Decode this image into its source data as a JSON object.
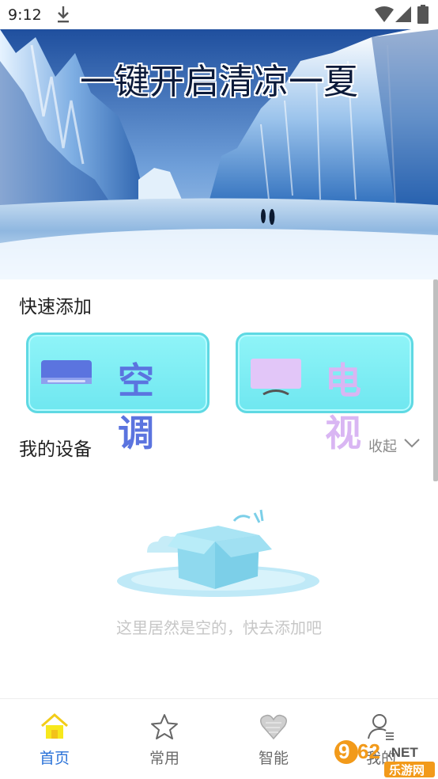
{
  "status_bar": {
    "time": "9:12",
    "icons": [
      "download-icon",
      "wifi-icon",
      "signal-icon",
      "battery-icon"
    ]
  },
  "banner": {
    "title": "一键开启清凉一夏"
  },
  "quick_add": {
    "section_title": "快速添加",
    "items": [
      {
        "label": "空调",
        "icon": "air-conditioner-icon",
        "text_color": "#5b74df"
      },
      {
        "label": "电视",
        "icon": "tv-icon",
        "text_color": "#d9b6f3"
      }
    ]
  },
  "my_devices": {
    "section_title": "我的设备",
    "collapse_label": "收起",
    "empty_text": "这里居然是空的，快去添加吧",
    "empty_icon": "empty-box-icon"
  },
  "bottom_nav": {
    "active_color": "#2a72d8",
    "items": [
      {
        "label": "首页",
        "icon": "home-icon",
        "active": true
      },
      {
        "label": "常用",
        "icon": "star-icon",
        "active": false
      },
      {
        "label": "智能",
        "icon": "heart-icon",
        "active": false
      },
      {
        "label": "我的",
        "icon": "user-icon",
        "active": false
      }
    ]
  },
  "watermark": {
    "number": "962",
    "suffix": ".NET",
    "caption": "乐游网"
  },
  "colors": {
    "quick_button_bg": "#7eeef5",
    "quick_button_border": "#5fd9e3",
    "collapse_text": "#8a8a8a",
    "empty_text": "#c7c7c7"
  }
}
